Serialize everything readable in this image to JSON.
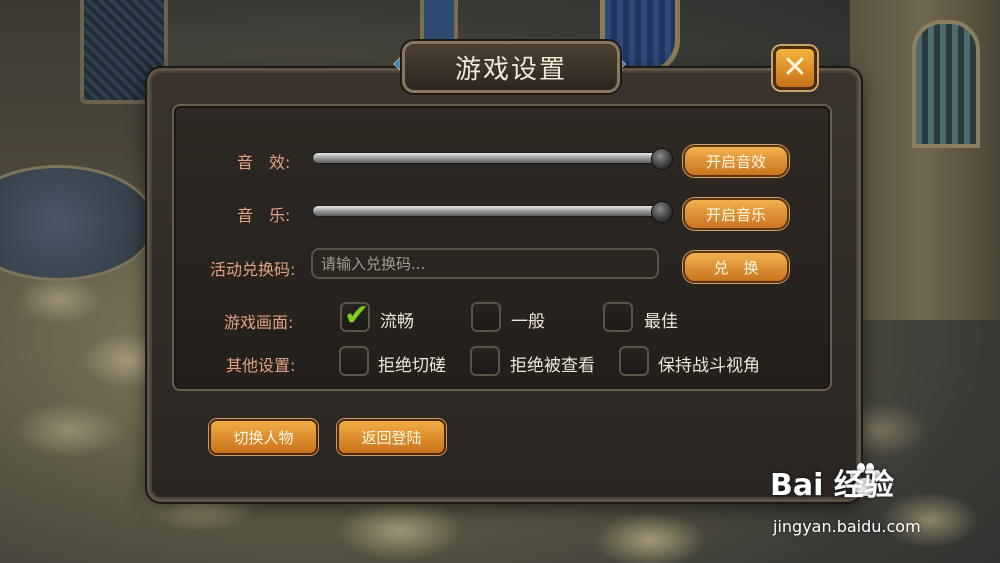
{
  "dialog": {
    "title": "游戏设置",
    "close_symbol": "✕"
  },
  "sound_effect": {
    "label": "音　效:",
    "level": 1.0,
    "button": "开启音效"
  },
  "music": {
    "label": "音　乐:",
    "level": 1.0,
    "button": "开启音乐"
  },
  "redeem": {
    "label": "活动兑换码:",
    "placeholder": "请输入兑换码...",
    "button": "兑　换"
  },
  "graphics": {
    "label": "游戏画面:",
    "options": [
      {
        "label": "流畅",
        "checked": true
      },
      {
        "label": "一般",
        "checked": false
      },
      {
        "label": "最佳",
        "checked": false
      }
    ]
  },
  "other": {
    "label": "其他设置:",
    "options": [
      {
        "label": "拒绝切磋",
        "checked": false
      },
      {
        "label": "拒绝被查看",
        "checked": false
      },
      {
        "label": "保持战斗视角",
        "checked": false
      }
    ]
  },
  "footer": {
    "switch_character": "切换人物",
    "return_login": "返回登陆"
  },
  "watermark": {
    "brand": "Bai  经验",
    "url": "jingyan.baidu.com"
  },
  "colors": {
    "label": "#e0a184",
    "accent": "#f2b14e",
    "check": "#7fcf1e"
  },
  "icons": [
    "close-icon",
    "check-icon",
    "slider-knob",
    "gem-icon",
    "baidu-paw-icon"
  ]
}
